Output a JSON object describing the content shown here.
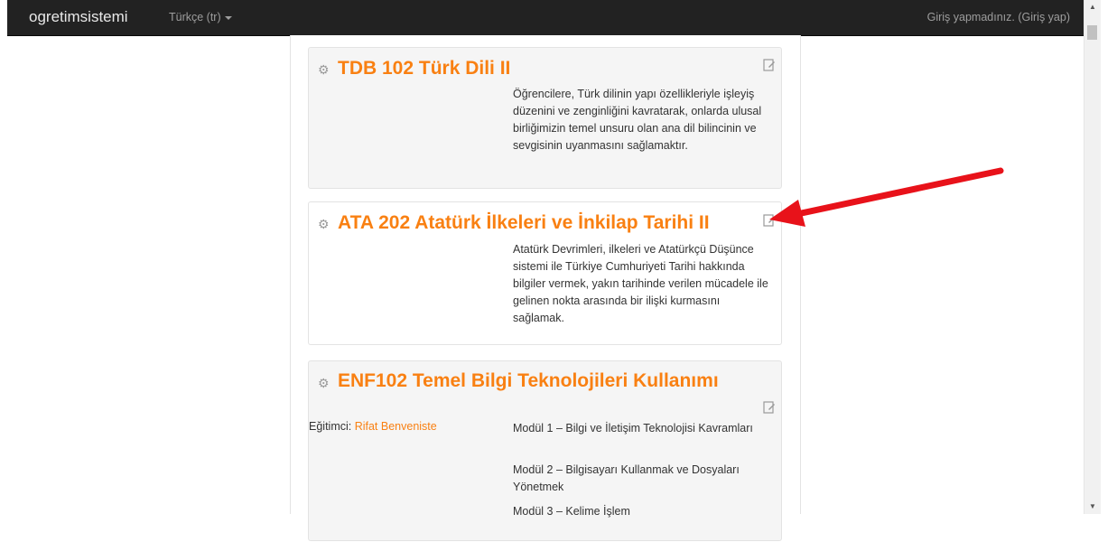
{
  "navbar": {
    "brand": "ogretimsistemi",
    "language": "Türkçe ‎(tr)‎",
    "login_text": "Giriş yapmadınız. (",
    "login_link": "Giriş yap",
    "login_close": ")"
  },
  "courses": [
    {
      "title": "TDB 102 Türk Dili II",
      "summary": "Öğrencilere, Türk dilinin yapı özellikleriyle işleyiş düzenini ve zenginliğini kavratarak, onlarda ulusal birliğimizin temel unsuru olan ana dil bilincinin ve sevgisinin uyanmasını sağlamaktır."
    },
    {
      "title": "ATA 202 Atatürk İlkeleri ve İnkilap Tarihi II",
      "summary": "Atatürk Devrimleri, ilkeleri ve Atatürkçü Düşünce sistemi ile Türkiye Cumhuriyeti Tarihi hakkında bilgiler vermek, yakın tarihinde verilen mücadele ile gelinen nokta arasında bir ilişki kurmasını sağlamak."
    },
    {
      "title": "ENF102 Temel Bilgi Teknolojileri Kullanımı",
      "teacher_label": "Eğitimci: ",
      "teacher_name": "Rifat Benveniste",
      "modules": [
        "Modül 1 – Bilgi ve İletişim Teknolojisi Kavramları",
        "Modül 2 – Bilgisayarı Kullanmak ve Dosyaları Yönetmek",
        "Modül 3 – Kelime İşlem"
      ]
    }
  ],
  "colors": {
    "accent": "#f98012",
    "navbar": "#222222",
    "annotation_arrow": "#e8121a"
  }
}
